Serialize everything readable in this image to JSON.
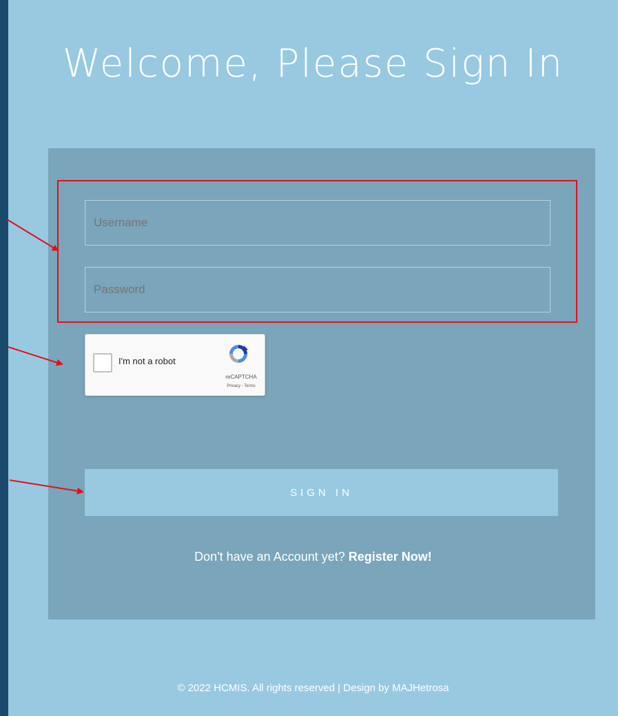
{
  "header": {
    "title": "Welcome, Please Sign In"
  },
  "form": {
    "username_placeholder": "Username",
    "password_placeholder": "Password",
    "recaptcha": {
      "label": "I'm not a robot",
      "brand": "reCAPTCHA",
      "terms": "Privacy - Terms"
    },
    "signin_label": "SIGN IN",
    "register_prompt": "Don't have an Account yet?",
    "register_link": "Register Now!"
  },
  "footer": {
    "text": "© 2022 HCMIS. All rights reserved | Design by MAJHetrosa"
  },
  "colors": {
    "page_bg": "#98c9e1",
    "card_bg": "#7aa5ba",
    "frame": "#1a4a6b",
    "annotation": "#e0101e"
  }
}
